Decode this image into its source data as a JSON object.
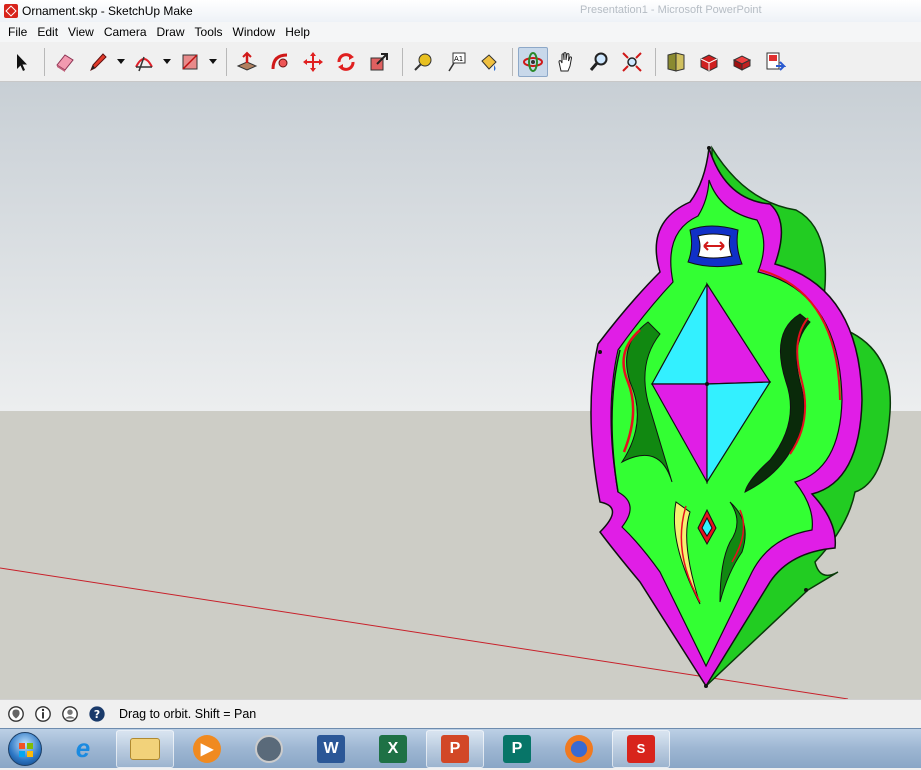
{
  "window": {
    "title": "Ornament.skp - SketchUp Make",
    "background_title": "Presentation1 - Microsoft PowerPoint"
  },
  "menu": [
    "File",
    "Edit",
    "View",
    "Camera",
    "Draw",
    "Tools",
    "Window",
    "Help"
  ],
  "toolbar": {
    "tools": [
      "select-tool",
      "eraser-tool",
      "pencil-tool",
      "arc-tool",
      "rectangle-tool",
      "push-pull-tool",
      "follow-me-tool",
      "move-tool",
      "rotate-tool",
      "scale-tool",
      "tape-measure-tool",
      "text-tool",
      "paint-bucket-tool",
      "orbit-tool",
      "pan-tool",
      "zoom-tool",
      "zoom-extents-tool",
      "3d-warehouse-tool",
      "extension-warehouse-tool",
      "components-tool",
      "send-to-layout-tool"
    ],
    "active_tool": "orbit-tool"
  },
  "status": {
    "message": "Drag to orbit.  Shift = Pan",
    "icons": [
      "geo-location-icon",
      "credits-icon",
      "user-icon",
      "help-icon"
    ]
  },
  "taskbar": {
    "apps": [
      "internet-explorer",
      "windows-explorer",
      "media-player",
      "dvd-maker",
      "word",
      "excel",
      "powerpoint",
      "publisher",
      "firefox",
      "sketchup"
    ],
    "colors": {
      "word": "#2b5797",
      "excel": "#1e7145",
      "powerpoint": "#d24726",
      "publisher": "#077568",
      "sketchup": "#d8241c"
    }
  },
  "scene": {
    "colors": {
      "sky": "#d2d8dc",
      "ground": "#cdcdc6",
      "face_green": "#33ff33",
      "border_magenta": "#e01ee6",
      "side_green": "#22cc22",
      "cyan": "#33f0ff",
      "accent_red": "#e60f1e",
      "axis_red": "#c8202a"
    }
  }
}
